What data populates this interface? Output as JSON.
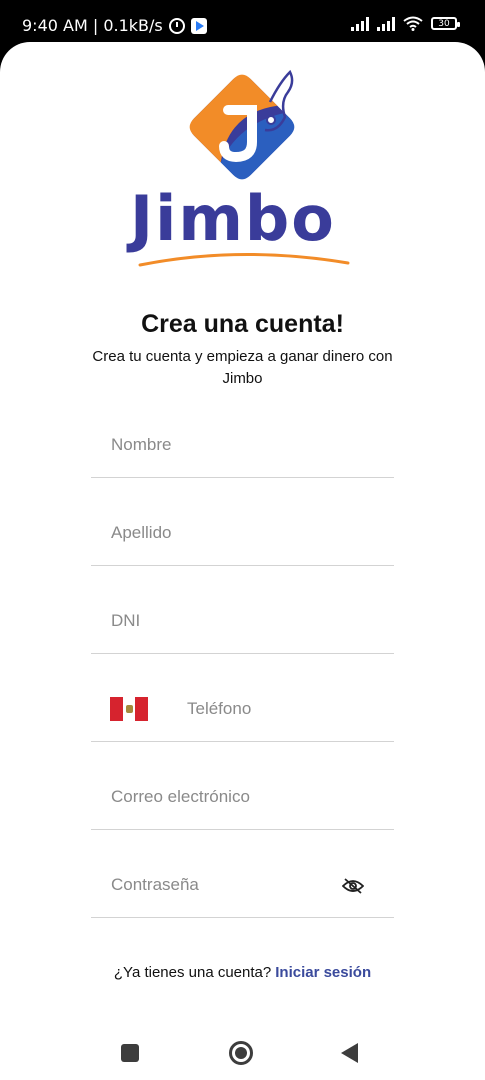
{
  "status_bar": {
    "time_speed": "9:40 AM | 0.1kB/s",
    "battery": "30"
  },
  "logo": {
    "letter": "J",
    "brand": "Jimbo"
  },
  "header": {
    "title": "Crea una cuenta!",
    "subtitle": "Crea tu cuenta y empieza a ganar dinero con Jimbo"
  },
  "form": {
    "nombre": "Nombre",
    "apellido": "Apellido",
    "dni": "DNI",
    "telefono": "Teléfono",
    "correo": "Correo electrónico",
    "contrasena": "Contraseña"
  },
  "footer": {
    "question": "¿Ya tienes una cuenta?",
    "login_link": "Iniciar sesión"
  },
  "icons": {
    "eye_toggle": "eye-off-icon",
    "flag": "peru-flag-icon",
    "nav_recent": "square-icon",
    "nav_home": "circle-icon",
    "nav_back": "triangle-back-icon"
  },
  "colors": {
    "brand_blue": "#3a3c9a",
    "brand_orange": "#f28c28",
    "link": "#3a4a9c"
  }
}
